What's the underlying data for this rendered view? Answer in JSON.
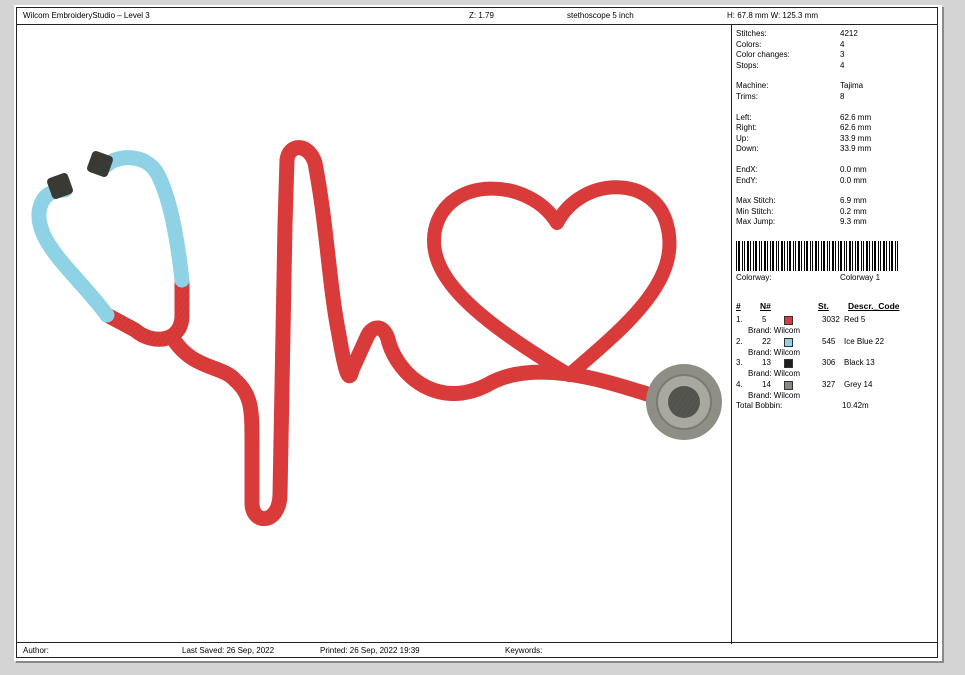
{
  "header": {
    "app_title": "Wilcom EmbroideryStudio – Level 3",
    "zoom": "Z: 1.79",
    "design_name": "stethoscope 5 inch",
    "size": "H: 67.8 mm   W: 125.3 mm"
  },
  "stats": [
    {
      "label": "Stitches:",
      "value": "4212"
    },
    {
      "label": "Colors:",
      "value": "4"
    },
    {
      "label": "Color changes:",
      "value": "3"
    },
    {
      "label": "Stops:",
      "value": "4"
    },
    {
      "label": "Machine:",
      "value": "Tajima"
    },
    {
      "label": "Trims:",
      "value": "8"
    },
    {
      "label": "Left:",
      "value": "62.6 mm"
    },
    {
      "label": "Right:",
      "value": "62.6 mm"
    },
    {
      "label": "Up:",
      "value": "33.9 mm"
    },
    {
      "label": "Down:",
      "value": "33.9 mm"
    },
    {
      "label": "EndX:",
      "value": "0.0 mm"
    },
    {
      "label": "EndY:",
      "value": "0.0 mm"
    },
    {
      "label": "Max Stitch:",
      "value": "6.9 mm"
    },
    {
      "label": "Min Stitch:",
      "value": "0.2 mm"
    },
    {
      "label": "Max Jump:",
      "value": "9.3 mm"
    }
  ],
  "colorway": {
    "label": "Colorway:",
    "value": "Colorway 1"
  },
  "table_headers": {
    "idx": "#",
    "num": "N#",
    "st": "St.",
    "desc": "Descr._Code"
  },
  "colors": [
    {
      "idx": "1.",
      "num": "5",
      "hex": "#d93a3a",
      "stitches": "3032",
      "desc": "Red 5",
      "brand": "Brand: Wilcom"
    },
    {
      "idx": "2.",
      "num": "22",
      "hex": "#8fd2e6",
      "stitches": "545",
      "desc": "Ice Blue 22",
      "brand": "Brand: Wilcom"
    },
    {
      "idx": "3.",
      "num": "13",
      "hex": "#1e1e1e",
      "stitches": "306",
      "desc": "Black 13",
      "brand": "Brand: Wilcom"
    },
    {
      "idx": "4.",
      "num": "14",
      "hex": "#8a8a80",
      "stitches": "327",
      "desc": "Grey 14",
      "brand": "Brand: Wilcom"
    }
  ],
  "bobbin": {
    "label": "Total Bobbin:",
    "value": "10.42m"
  },
  "footer": {
    "author": "Author:",
    "last_saved": "Last Saved: 26 Sep, 2022",
    "printed": "Printed: 26 Sep, 2022 19:39",
    "keywords": "Keywords:"
  },
  "thread_colors": {
    "red": "#d93a3a",
    "ice_blue": "#8fd2e6",
    "black": "#3a3a35",
    "grey": "#8e8e84"
  }
}
